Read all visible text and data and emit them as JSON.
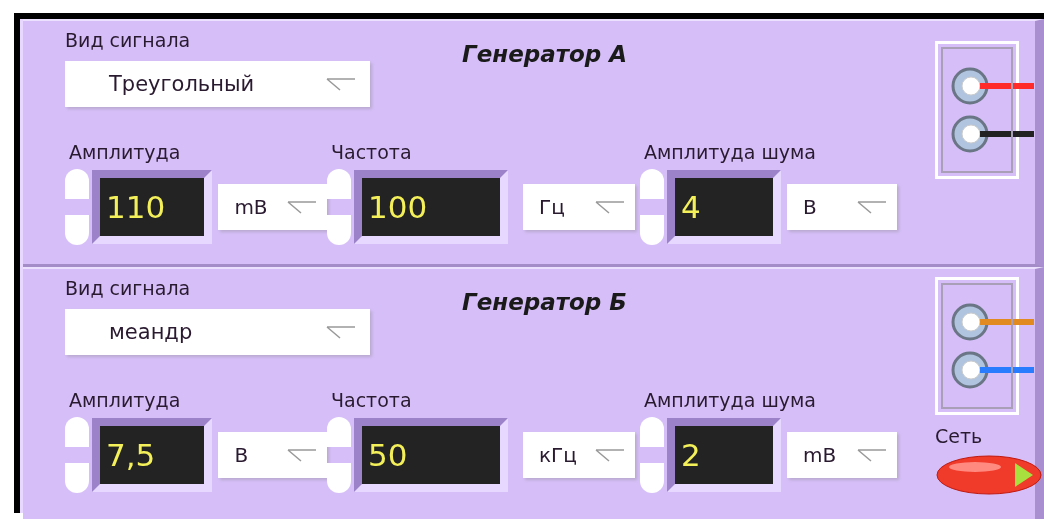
{
  "generators": [
    {
      "title": "Генератор А",
      "signal": {
        "label": "Вид сигнала",
        "value": "Треугольный"
      },
      "controls": [
        {
          "label": "Амплитуда",
          "value": "110",
          "unit": "mB"
        },
        {
          "label": "Частота",
          "value": "100",
          "unit": "Гц"
        },
        {
          "label": "Амплитуда шума",
          "value": "4",
          "unit": "В"
        }
      ],
      "terminals": [
        {
          "color": "#ff2a2a"
        },
        {
          "color": "#222222"
        }
      ]
    },
    {
      "title": "Генератор Б",
      "signal": {
        "label": "Вид сигнала",
        "value": "меандр"
      },
      "controls": [
        {
          "label": "Амплитуда",
          "value": "7,5",
          "unit": "В"
        },
        {
          "label": "Частота",
          "value": "50",
          "unit": "кГц"
        },
        {
          "label": "Амплитуда шума",
          "value": "2",
          "unit": "mB"
        }
      ],
      "terminals": [
        {
          "color": "#e08a20"
        },
        {
          "color": "#2a7cff"
        }
      ],
      "power": {
        "label": "Сеть"
      }
    }
  ]
}
